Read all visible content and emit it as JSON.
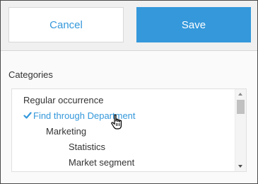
{
  "buttons": {
    "cancel_label": "Cancel",
    "save_label": "Save"
  },
  "categories": {
    "label": "Categories",
    "items": [
      {
        "label": "Regular occurrence",
        "level": 0,
        "selected": false
      },
      {
        "label": "Find through Department",
        "level": 0,
        "selected": true
      },
      {
        "label": "Marketing",
        "level": 1,
        "selected": false
      },
      {
        "label": "Statistics",
        "level": 2,
        "selected": false
      },
      {
        "label": "Market segment",
        "level": 2,
        "selected": false
      }
    ]
  },
  "icons": {
    "selected_item": "checkmark-icon",
    "pointer": "hand-pointer-cursor-icon"
  },
  "colors": {
    "accent": "#3498db",
    "text": "#333333"
  }
}
